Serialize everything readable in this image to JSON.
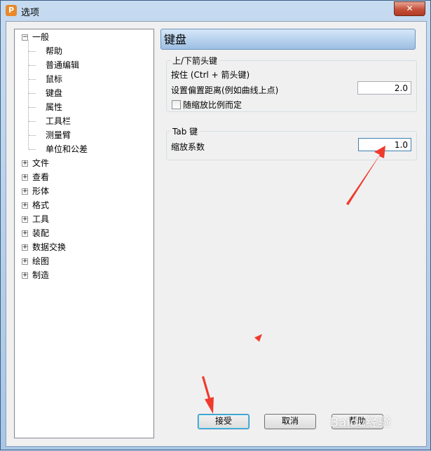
{
  "window": {
    "title": "选项",
    "close_glyph": "✕",
    "app_icon": "P"
  },
  "tree": {
    "items": [
      {
        "label": "一般",
        "level": 0,
        "expander": "−"
      },
      {
        "label": "帮助",
        "level": 1
      },
      {
        "label": "普通编辑",
        "level": 1
      },
      {
        "label": "鼠标",
        "level": 1
      },
      {
        "label": "键盘",
        "level": 1,
        "selected": true
      },
      {
        "label": "属性",
        "level": 1
      },
      {
        "label": "工具栏",
        "level": 1
      },
      {
        "label": "测量臂",
        "level": 1
      },
      {
        "label": "单位和公差",
        "level": 1
      },
      {
        "label": "文件",
        "level": 0,
        "expander": "+"
      },
      {
        "label": "查看",
        "level": 0,
        "expander": "+"
      },
      {
        "label": "形体",
        "level": 0,
        "expander": "+"
      },
      {
        "label": "格式",
        "level": 0,
        "expander": "+"
      },
      {
        "label": "工具",
        "level": 0,
        "expander": "+"
      },
      {
        "label": "装配",
        "level": 0,
        "expander": "+"
      },
      {
        "label": "数据交换",
        "level": 0,
        "expander": "+"
      },
      {
        "label": "绘图",
        "level": 0,
        "expander": "+"
      },
      {
        "label": "制造",
        "level": 0,
        "expander": "+"
      }
    ]
  },
  "panel": {
    "header": "键盘",
    "arrow_keys": {
      "title": "上/下箭头键",
      "hint": "按住 (Ctrl + 箭头键)",
      "offset_label": "设置偏置距离(例如曲线上点)",
      "offset_value": "2.0",
      "scale_check_label": "随缩放比例而定"
    },
    "tab_key": {
      "title": "Tab 键",
      "factor_label": "缩放系数",
      "factor_value": "1.0"
    }
  },
  "buttons": {
    "accept": "接受",
    "cancel": "取消",
    "help": "帮助"
  },
  "watermark": "Baidu经验",
  "colors": {
    "annotation_arrow": "#f03a2e"
  }
}
